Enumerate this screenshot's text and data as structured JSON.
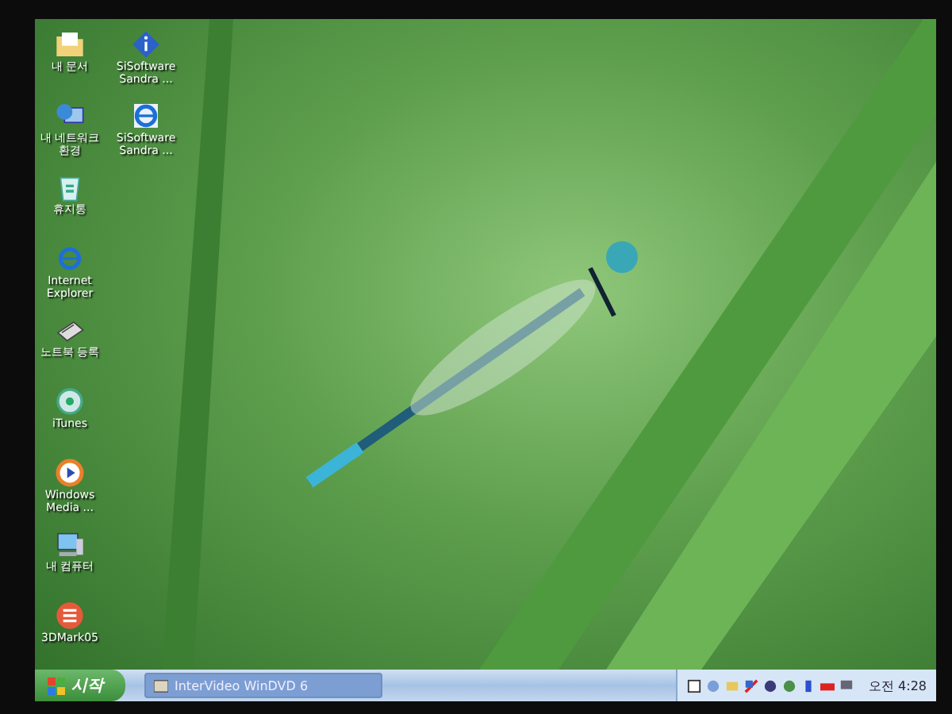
{
  "desktop": {
    "icon_columns": [
      [
        {
          "label": "내 문서",
          "kind": "documents"
        },
        {
          "label": "내 네트워크 환경",
          "kind": "network"
        },
        {
          "label": "휴지통",
          "kind": "recycle"
        },
        {
          "label": "Internet Explorer",
          "kind": "browser"
        },
        {
          "label": "노트북 등록",
          "kind": "notebook"
        },
        {
          "label": "iTunes",
          "kind": "music"
        },
        {
          "label": "Windows Media ...",
          "kind": "media"
        },
        {
          "label": "내 컴퓨터",
          "kind": "computer"
        },
        {
          "label": "3DMark05",
          "kind": "benchmark"
        }
      ],
      [
        {
          "label": "SiSoftware Sandra ...",
          "kind": "info"
        },
        {
          "label": "SiSoftware Sandra ...",
          "kind": "browser"
        }
      ]
    ]
  },
  "taskbar": {
    "start_button": "시작",
    "tasks": [
      {
        "label": "InterVideo WinDVD 6"
      }
    ],
    "clock": "오전 4:28"
  }
}
